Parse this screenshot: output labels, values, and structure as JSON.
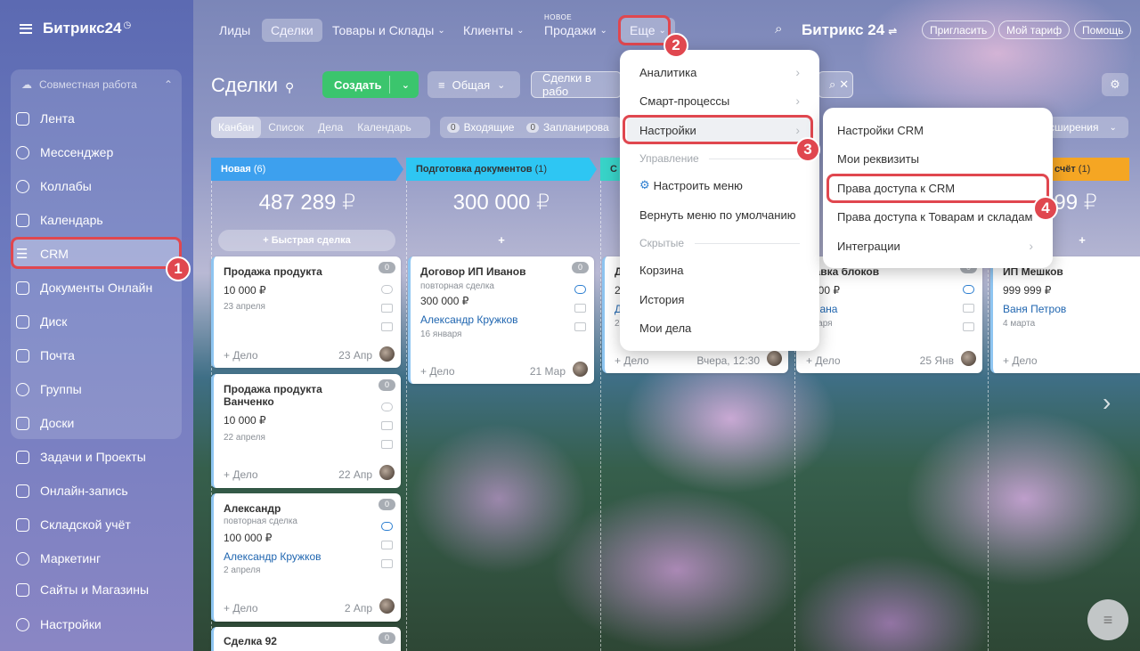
{
  "app": {
    "logo": "Битрикс24"
  },
  "sidebar": {
    "group": "Совместная работа",
    "items": [
      "Лента",
      "Мессенджер",
      "Коллабы",
      "Календарь",
      "CRM",
      "Документы Онлайн",
      "Диск",
      "Почта",
      "Группы",
      "Доски",
      "Задачи и Проекты",
      "Онлайн-запись",
      "Складской учёт",
      "Маркетинг",
      "Сайты и Магазины",
      "Настройки"
    ]
  },
  "topnav": {
    "items": [
      "Лиды",
      "Сделки",
      "Товары и Склады",
      "Клиенты",
      "Продажи",
      "Еще"
    ],
    "new_badge": "НОВОЕ",
    "brand": "Битрикс 24",
    "invite": "Пригласить",
    "tariff": "Мой тариф",
    "help": "Помощь"
  },
  "page": {
    "title": "Сделки",
    "create": "Создать",
    "filter": "Общая",
    "search": "Сделки в рабо",
    "views": [
      "Канбан",
      "Список",
      "Дела",
      "Календарь"
    ],
    "counters": [
      {
        "n": "0",
        "label": "Входящие"
      },
      {
        "n": "0",
        "label": "Запланирова"
      }
    ],
    "ext": "сширения"
  },
  "columns": [
    {
      "name": "Новая",
      "count": "(6)",
      "sum": "487 289 ₽",
      "add": "+ Быстрая сделка",
      "color": "#3da0ee"
    },
    {
      "name": "Подготовка документов",
      "count": "(1)",
      "sum": "300 000 ₽",
      "add": "+",
      "color": "#2ec6f3"
    },
    {
      "name": "С",
      "count": "",
      "sum": "",
      "add": "",
      "color": "#38d3c8"
    },
    {
      "name": "",
      "count": "",
      "sum": "",
      "add": "",
      "color": "#8cd34d"
    },
    {
      "name": "счёт",
      "count": "(1)",
      "sum": "9 999 ₽",
      "add": "+",
      "color": "#f5a623"
    }
  ],
  "cards": [
    {
      "title": "Продажа продукта",
      "amount": "10 000 ₽",
      "date": "23 апреля",
      "deal": "+ Дело",
      "cdate": "23 Апр",
      "count": "0"
    },
    {
      "title": "Продажа продукта Ванченко",
      "amount": "10 000 ₽",
      "date": "22 апреля",
      "deal": "+ Дело",
      "cdate": "22 Апр",
      "count": "0"
    },
    {
      "title": "Александр",
      "sub": "повторная сделка",
      "amount": "100 000 ₽",
      "link": "Александр Кружков",
      "date": "2 апреля",
      "deal": "+ Дело",
      "cdate": "2 Апр",
      "count": "0"
    },
    {
      "title": "Сделка 92",
      "count": "0"
    },
    {
      "title": "Договор ИП Иванов",
      "sub": "повторная сделка",
      "amount": "300 000 ₽",
      "link": "Александр Кружков",
      "date": "16 января",
      "deal": "+ Дело",
      "cdate": "21 Мар",
      "count": "0"
    },
    {
      "title": "Д",
      "amount": "2",
      "link": "Д",
      "date": "2",
      "deal": "+ Дело",
      "cdate": "Вчера, 12:30"
    },
    {
      "title": "ставка блоков",
      "amount": "0 000 ₽",
      "link": "етлана",
      "date": "января",
      "deal": "+ Дело",
      "cdate": "25 Янв",
      "count": "0"
    },
    {
      "title": "ИП Мешков",
      "amount": "999 999 ₽",
      "link": "Ваня Петров",
      "date": "4 марта",
      "deal": "+ Дело",
      "cdate": ""
    }
  ],
  "menu_more": {
    "items": [
      "Аналитика",
      "Смарт-процессы",
      "Настройки"
    ],
    "section1": "Управление",
    "configure": "Настроить меню",
    "reset": "Вернуть меню по умолчанию",
    "section2": "Скрытые",
    "hidden": [
      "Корзина",
      "История",
      "Мои дела"
    ]
  },
  "menu_settings": {
    "items": [
      "Настройки CRM",
      "Мои реквизиты",
      "Права доступа к CRM",
      "Права доступа к Товарам и складам",
      "Интеграции"
    ]
  },
  "callouts": [
    "1",
    "2",
    "3",
    "4"
  ]
}
